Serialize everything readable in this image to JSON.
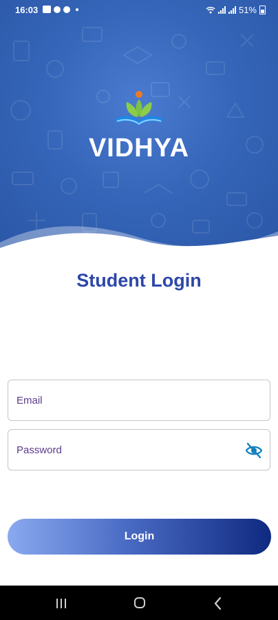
{
  "status_bar": {
    "time": "16:03",
    "battery": "51%",
    "icons": [
      "notification-icon",
      "fan-icon",
      "settings-icon",
      "dot-icon",
      "wifi-icon",
      "signal-icon",
      "signal-icon",
      "battery-icon"
    ]
  },
  "header": {
    "brand_name": "VIDHYA",
    "logo": "book-with-leaves-logo",
    "colors": {
      "primary": "#3566b9",
      "title": "#2d47a8"
    }
  },
  "login": {
    "title": "Student Login",
    "email_placeholder": "Email",
    "password_placeholder": "Password",
    "password_toggle_icon": "eye-off-icon",
    "button_label": "Login"
  },
  "nav_bar": {
    "icons": [
      "recents-icon",
      "home-icon",
      "back-icon"
    ]
  }
}
